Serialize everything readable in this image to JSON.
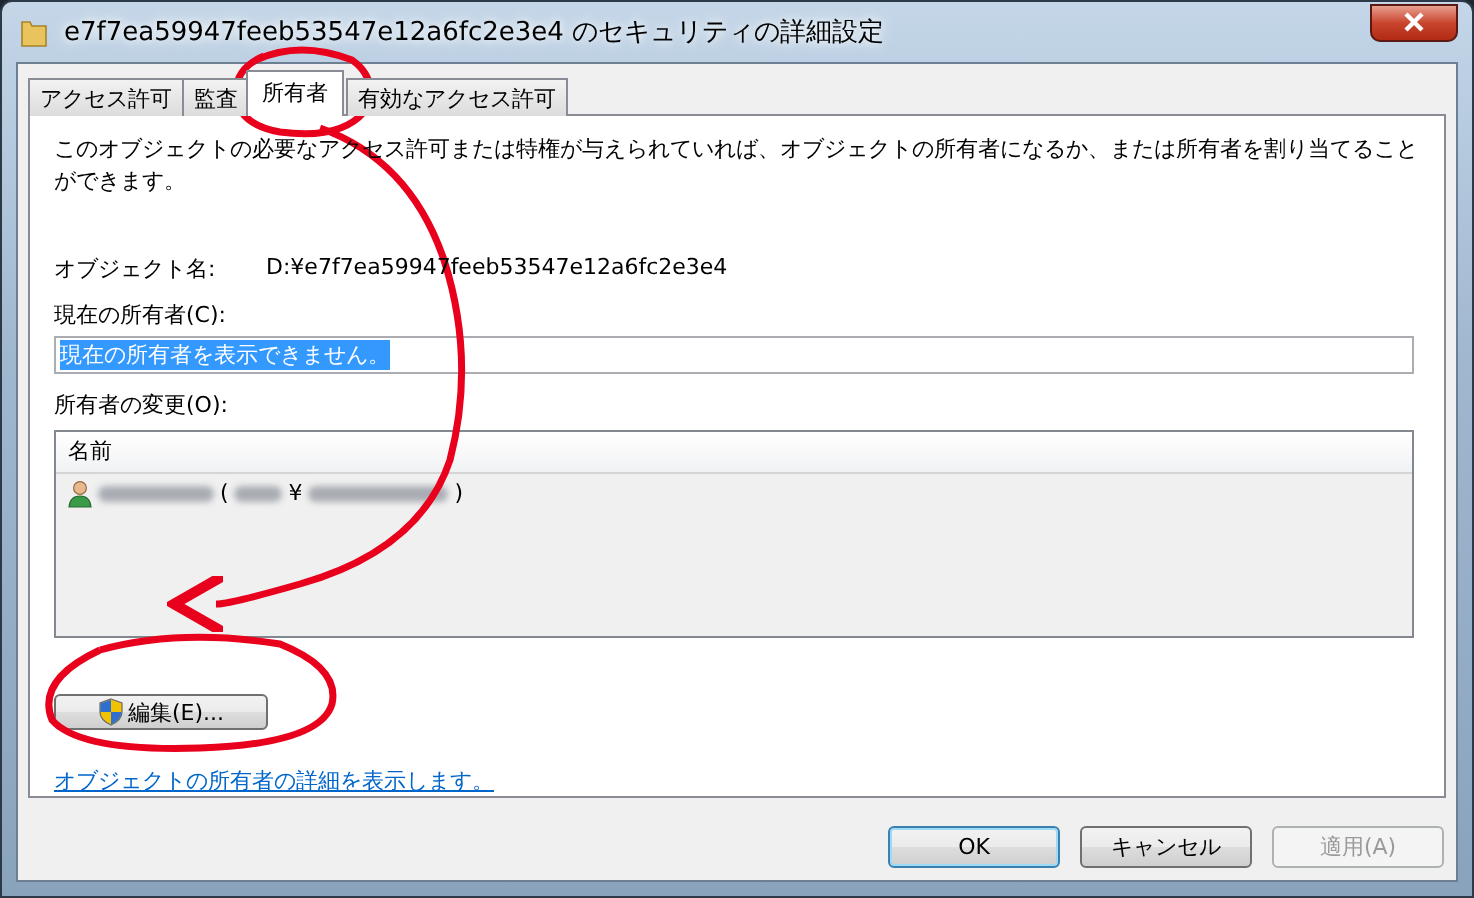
{
  "window": {
    "title": "e7f7ea59947feeb53547e12a6fc2e3e4 のセキュリティの詳細設定"
  },
  "tabs": [
    {
      "label": "アクセス許可",
      "selected": false
    },
    {
      "label": "監査",
      "selected": false
    },
    {
      "label": "所有者",
      "selected": true
    },
    {
      "label": "有効なアクセス許可",
      "selected": false
    }
  ],
  "owner_panel": {
    "description": "このオブジェクトの必要なアクセス許可または特権が与えられていれば、オブジェクトの所有者になるか、または所有者を割り当てることができます。",
    "object_name": {
      "label": "オブジェクト名:",
      "value": "D:¥e7f7ea59947feeb53547e12a6fc2e3e4"
    },
    "current_owner": {
      "label": "現在の所有者(C):",
      "value": "現在の所有者を表示できません。",
      "text_selected": true
    },
    "change_owner": {
      "label": "所有者の変更(O):",
      "columns": [
        "名前"
      ],
      "rows": [
        {
          "open": "(",
          "separator": "¥",
          "close": ")"
        }
      ]
    },
    "edit_button": {
      "label": "編集(E)..."
    },
    "link": "オブジェクトの所有者の詳細を表示します。"
  },
  "buttons": [
    {
      "label": "OK",
      "default": true,
      "disabled": false
    },
    {
      "label": "キャンセル",
      "default": false,
      "disabled": false
    },
    {
      "label": "適用(A)",
      "default": false,
      "disabled": true
    }
  ]
}
